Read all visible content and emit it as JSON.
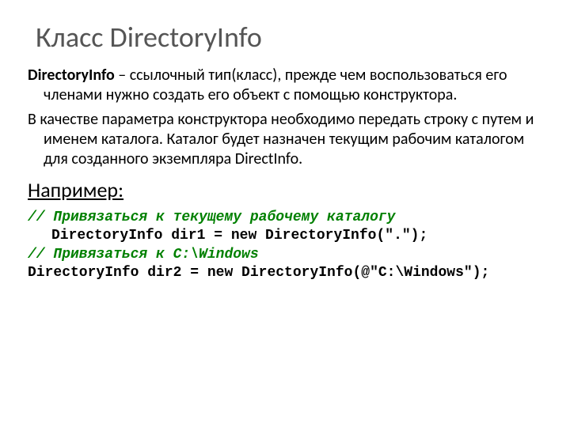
{
  "title": "Класс DirectoryInfo",
  "paragraph1": {
    "term": "DirectoryInfo",
    "text": " – ссылочный тип(класс), прежде чем воспользоваться его членами нужно создать его объект с помощью конструктора."
  },
  "paragraph2": "В качестве параметра конструктора необходимо передать строку с путем и именем каталога. Каталог будет назначен текущим рабочим каталогом для созданного экземпляра DirectInfo.",
  "example_label": "Например:",
  "code": {
    "comment1": "// Привязаться к текущему рабочему каталогу",
    "line1": "DirectoryInfo dir1 = new DirectoryInfo(\".\");",
    "comment2": "// Привязаться к C:\\Windows",
    "line2": "DirectoryInfo dir2 = new DirectoryInfo(@\"C:\\Windows\");"
  }
}
